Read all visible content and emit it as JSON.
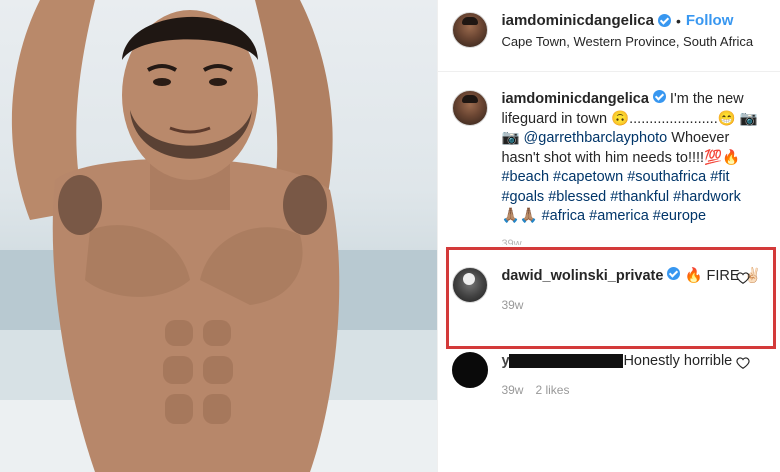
{
  "header": {
    "username": "iamdominicdangelica",
    "dot": "•",
    "follow_label": "Follow",
    "location": "Cape Town, Western Province, South Africa"
  },
  "caption": {
    "username": "iamdominicdangelica",
    "text_1": " I'm the new lifeguard in town 🙃......................😁 📷",
    "text_2": "📷 ",
    "mention": "@garrethbarclayphoto",
    "text_3": " Whoever hasn't shot with him needs to!!!!💯🔥",
    "tags_line1": "#beach #capetown #southafrica #fit",
    "tags_line2": "#goals #blessed #thankful #hardwork",
    "tags_line3_prefix": "🙏🏽🙏🏽 ",
    "tags_line3": "#africa #america #europe",
    "time_faded": "39w"
  },
  "comments": [
    {
      "username": "dawid_wolinski_private",
      "text": " 🔥 FIRE ✌🏻",
      "time": "39w"
    },
    {
      "username_redacted": "y",
      "text": "Honestly horrible",
      "time": "39w",
      "likes": "2 likes"
    }
  ],
  "colors": {
    "accent_blue": "#3897f0",
    "hashtag": "#003569",
    "highlight_red": "#d33a3a",
    "muted": "#999999"
  },
  "icons": {
    "verified": "verified-badge-icon",
    "heart": "heart-outline-icon"
  }
}
